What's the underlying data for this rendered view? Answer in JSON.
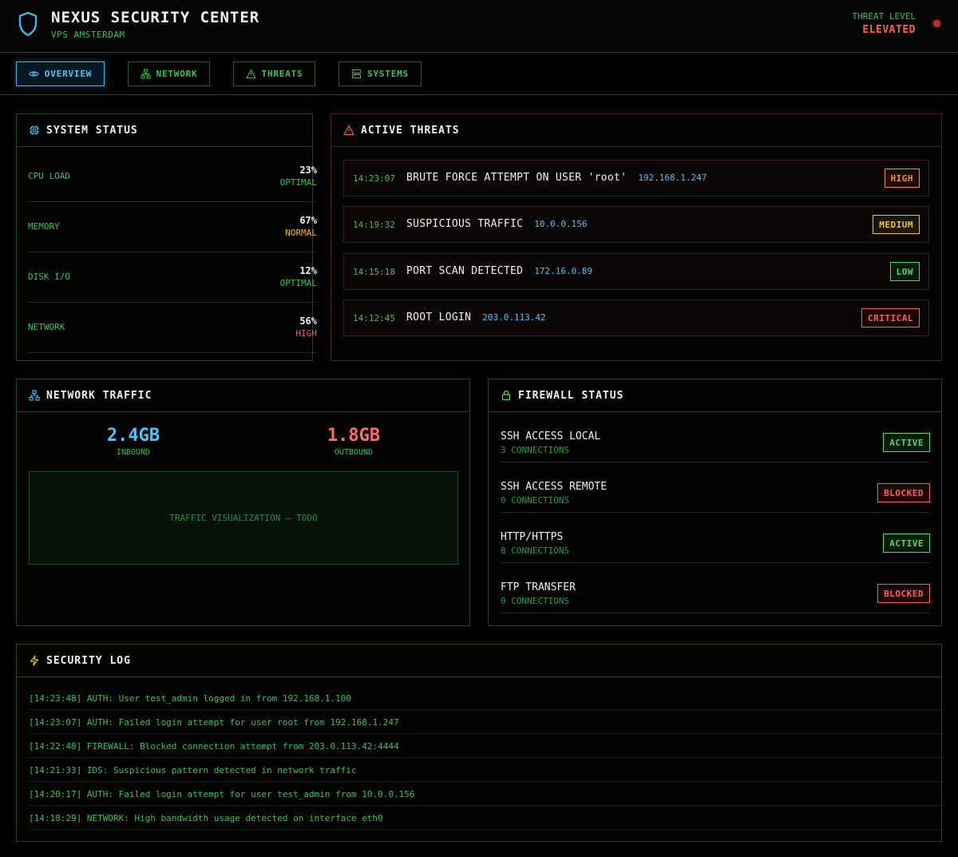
{
  "header": {
    "title": "NEXUS SECURITY CENTER",
    "subtitle": "VPS AMSTERDAM",
    "threat_level_label": "THREAT LEVEL",
    "threat_level_value": "ELEVATED"
  },
  "tabs": [
    {
      "label": "OVERVIEW",
      "icon": "eye-icon",
      "active": true
    },
    {
      "label": "NETWORK",
      "icon": "network-icon",
      "active": false
    },
    {
      "label": "THREATS",
      "icon": "warning-icon",
      "active": false
    },
    {
      "label": "SYSTEMS",
      "icon": "server-icon",
      "active": false
    }
  ],
  "system_status": {
    "title": "SYSTEM STATUS",
    "icon": "cpu-icon",
    "rows": [
      {
        "name": "CPU LOAD",
        "value": "23%",
        "state": "OPTIMAL",
        "state_color": "#3fbf5f"
      },
      {
        "name": "MEMORY",
        "value": "67%",
        "state": "NORMAL",
        "state_color": "#f0b429"
      },
      {
        "name": "DISK I/O",
        "value": "12%",
        "state": "OPTIMAL",
        "state_color": "#3fbf5f"
      },
      {
        "name": "NETWORK",
        "value": "56%",
        "state": "HIGH",
        "state_color": "#ff5c5c"
      }
    ]
  },
  "active_threats": {
    "title": "ACTIVE THREATS",
    "icon": "alert-triangle-icon",
    "rows": [
      {
        "time": "14:23:07",
        "message": "BRUTE FORCE ATTEMPT ON USER 'root'",
        "ip": "192.168.1.247",
        "severity": "HIGH",
        "color": "#ff8a3d",
        "bg": "#1a0c04"
      },
      {
        "time": "14:19:32",
        "message": "SUSPICIOUS TRAFFIC",
        "ip": "10.0.0.156",
        "severity": "MEDIUM",
        "color": "#f0c419",
        "bg": "#1a1604"
      },
      {
        "time": "14:15:18",
        "message": "PORT SCAN DETECTED",
        "ip": "172.16.0.89",
        "severity": "LOW",
        "color": "#4cd964",
        "bg": "#041a0a"
      },
      {
        "time": "14:12:45",
        "message": "ROOT LOGIN",
        "ip": "203.0.113.42",
        "severity": "CRITICAL",
        "color": "#ff5c5c",
        "bg": "#1a0606"
      }
    ]
  },
  "network_traffic": {
    "title": "NETWORK TRAFFIC",
    "icon": "network-icon",
    "inbound_value": "2.4GB",
    "inbound_label": "INBOUND",
    "outbound_value": "1.8GB",
    "outbound_label": "OUTBOUND",
    "viz_placeholder": "TRAFFIC VISUALIZATION — TODO"
  },
  "firewall": {
    "title": "FIREWALL STATUS",
    "icon": "lock-icon",
    "rows": [
      {
        "name": "SSH ACCESS LOCAL",
        "connections": "3 CONNECTIONS",
        "status": "ACTIVE",
        "color": "#4cd964",
        "bg": "#041a0a"
      },
      {
        "name": "SSH ACCESS REMOTE",
        "connections": "0 CONNECTIONS",
        "status": "BLOCKED",
        "color": "#ff5c5c",
        "bg": "#1a0606"
      },
      {
        "name": "HTTP/HTTPS",
        "connections": "8 CONNECTIONS",
        "status": "ACTIVE",
        "color": "#4cd964",
        "bg": "#041a0a"
      },
      {
        "name": "FTP TRANSFER",
        "connections": "0 CONNECTIONS",
        "status": "BLOCKED",
        "color": "#ff5c5c",
        "bg": "#1a0606"
      }
    ]
  },
  "security_log": {
    "title": "SECURITY LOG",
    "icon": "lightning-icon",
    "lines": [
      "[14:23:48] AUTH: User test_admin logged in from 192.168.1.100",
      "[14:23:07] AUTH: Failed login attempt for user root from 192.168.1.247",
      "[14:22:48] FIREWALL: Blocked connection attempt from 203.0.113.42:4444",
      "[14:21:33] IDS: Suspicious pattern detected in network traffic",
      "[14:20:17] AUTH: Failed login attempt for user test_admin from 10.0.0.156",
      "[14:18:29] NETWORK: High bandwidth usage detected on interface eth0"
    ]
  }
}
